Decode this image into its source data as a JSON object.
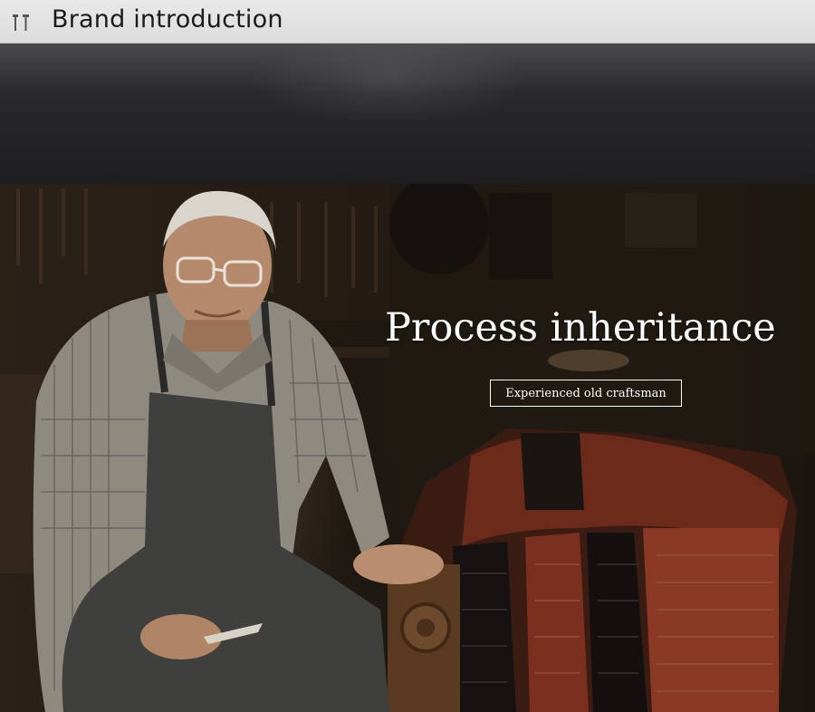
{
  "header": {
    "icon": "tools-icon",
    "title": "Brand introduction"
  },
  "hero": {
    "headline": "Process inheritance",
    "tagline": "Experienced old craftsman",
    "image": "photo of an elderly craftsman in an apron with exotic leather hides"
  },
  "colors": {
    "titlebar": "#e3e3e3",
    "band": "#2a2a2c",
    "text_on_hero": "#ffffff"
  }
}
